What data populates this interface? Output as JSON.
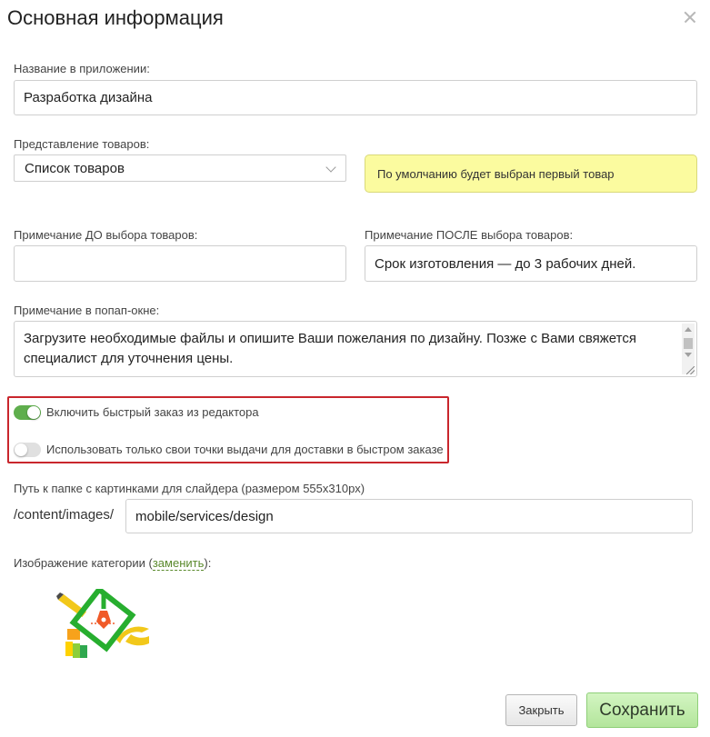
{
  "dialog": {
    "title": "Основная информация"
  },
  "fields": {
    "app_name": {
      "label": "Название в приложении:",
      "value": "Разработка дизайна"
    },
    "product_view": {
      "label": "Представление товаров:",
      "selected": "Список товаров"
    },
    "default_hint": "По умолчанию будет выбран первый товар",
    "note_before": {
      "label": "Примечание ДО выбора товаров:",
      "value": ""
    },
    "note_after": {
      "label": "Примечание ПОСЛЕ выбора товаров:",
      "value": "Срок изготовления — до 3 рабочих дней."
    },
    "popup_note": {
      "label": "Примечание в попап-окне:",
      "value": "Загрузите необходимые файлы и опишите Ваши пожелания по дизайну. Позже с Вами свяжется специалист для уточнения цены."
    }
  },
  "toggles": [
    {
      "label": "Включить быстрый заказ из редактора",
      "state": "on"
    },
    {
      "label": "Использовать только свои точки выдачи для доставки в быстром заказе",
      "state": "off"
    }
  ],
  "slider_path": {
    "label": "Путь к папке с картинками для слайдера (размером 555x310px)",
    "prefix": "/content/images/",
    "value": "mobile/services/design"
  },
  "category_image": {
    "label_start": "Изображение категории (",
    "link": "заменить",
    "label_end": "):",
    "icon": "design-tools-icon"
  },
  "buttons": {
    "close": "Закрыть",
    "save": "Сохранить"
  },
  "colors": {
    "toggle_on": "#5fae4d",
    "highlight_border": "#c9262d",
    "hint_bg": "#fbfb9f",
    "save_bg": "#c3eeaf"
  }
}
